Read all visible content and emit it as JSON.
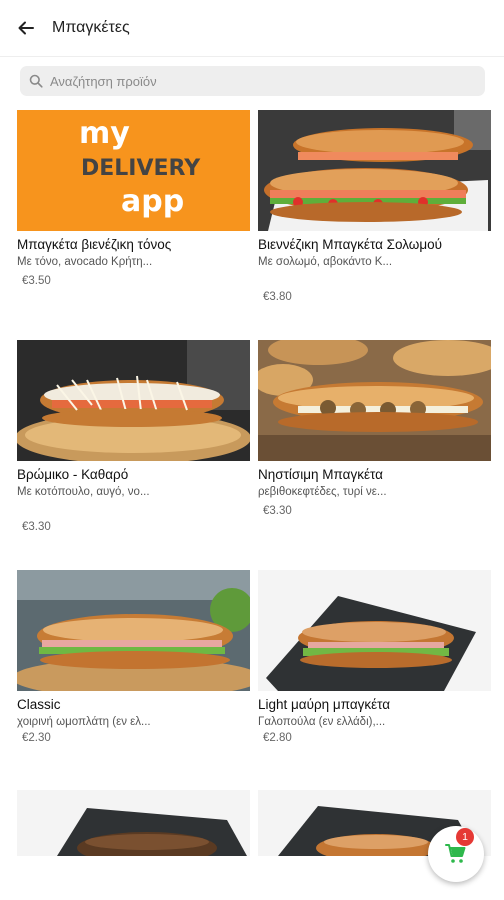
{
  "header": {
    "title": "Μπαγκέτες",
    "back_icon": "arrow-left-icon"
  },
  "search": {
    "placeholder": "Αναζήτηση προϊόν",
    "icon": "search-icon"
  },
  "products": [
    {
      "name": "Μπαγκέτα βιενέζικη τόνος",
      "description": "Με τόνο, avocado Κρήτη...",
      "price": "€3.50",
      "image": "my DELIVERY app logo"
    },
    {
      "name": "Βιεννέζικη Μπαγκέτα Σολωμού",
      "description": "Με σολωμό, αβοκάντο Κ...",
      "price": "€3.80"
    },
    {
      "name": "Βρώμικο - Καθαρό",
      "description": "Με κοτόπουλο, αυγό, νο...",
      "price": "€3.30"
    },
    {
      "name": "Νηστίσιμη Μπαγκέτα",
      "description": "ρεβιθοκεφτέδες, τυρί νε...",
      "price": "€3.30"
    },
    {
      "name": "Classic",
      "description": "χοιρινή ωμοπλάτη (εν ελ...",
      "price": "€2.30"
    },
    {
      "name": "Light μαύρη μπαγκέτα",
      "description": "Γαλοπούλα (εν ελλάδι),...",
      "price": "€2.80"
    }
  ],
  "placeholder_logo": {
    "line1": "my",
    "line2": "DELIVERY",
    "line3": "app",
    "bg_color": "#f7941d"
  },
  "cart": {
    "count": "1",
    "icon": "shopping-cart-icon",
    "icon_color": "#2eb84c",
    "badge_color": "#e53935"
  }
}
